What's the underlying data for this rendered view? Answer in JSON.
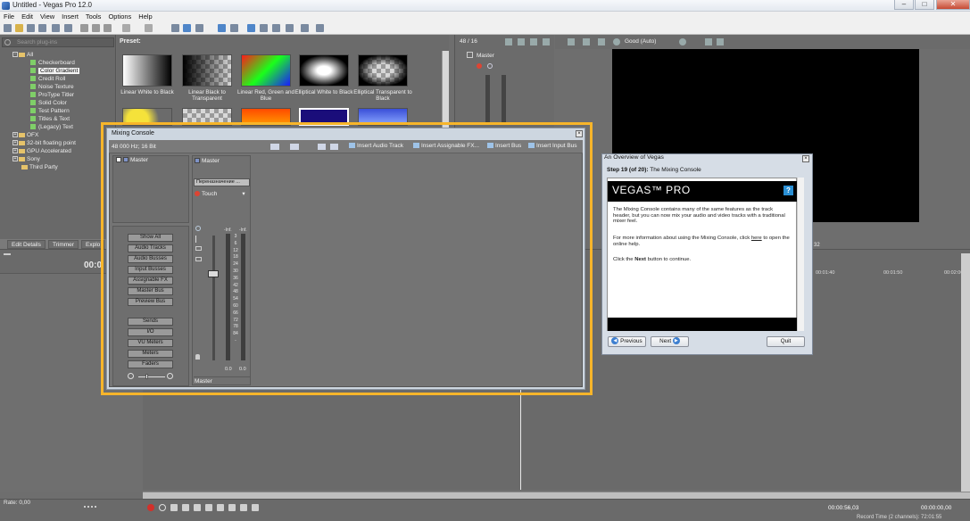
{
  "window": {
    "title": "Untitled - Vegas Pro 12.0"
  },
  "menu": [
    "File",
    "Edit",
    "View",
    "Insert",
    "Tools",
    "Options",
    "Help"
  ],
  "plugins": {
    "search_placeholder": "Search plug-ins",
    "tree": [
      {
        "label": "All",
        "type": "folder",
        "expanded": true
      },
      {
        "label": "Checkerboard",
        "type": "fx"
      },
      {
        "label": "Color Gradient",
        "type": "fx",
        "selected": true
      },
      {
        "label": "Credit Roll",
        "type": "fx"
      },
      {
        "label": "Noise Texture",
        "type": "fx"
      },
      {
        "label": "ProType Titler",
        "type": "fx"
      },
      {
        "label": "Solid Color",
        "type": "fx"
      },
      {
        "label": "Test Pattern",
        "type": "fx"
      },
      {
        "label": "Titles & Text",
        "type": "fx"
      },
      {
        "label": "(Legacy) Text",
        "type": "fx"
      },
      {
        "label": "OFX",
        "type": "folder"
      },
      {
        "label": "32-bit floating point",
        "type": "folder"
      },
      {
        "label": "GPU Accelerated",
        "type": "folder"
      },
      {
        "label": "Sony",
        "type": "folder"
      },
      {
        "label": "Third Party",
        "type": "folder"
      }
    ]
  },
  "preset": {
    "title": "Preset:",
    "items": [
      {
        "label": "Linear White to Black"
      },
      {
        "label": "Linear Black to Transparent"
      },
      {
        "label": "Linear Red, Green and Blue"
      },
      {
        "label": "Elliptical White to Black"
      },
      {
        "label": "Elliptical Transparent to Black"
      }
    ]
  },
  "masterbus": {
    "header": "48 / 16",
    "label": "Master"
  },
  "preview": {
    "quality": "Good (Auto)"
  },
  "tabs": [
    "Edit Details",
    "Trimmer",
    "Explo"
  ],
  "timeline": {
    "timecode": "00:0",
    "ruler": [
      "00:01:40",
      "00:01:50",
      "00:02:00"
    ],
    "ruler_partial": "32"
  },
  "transport": {
    "rate": "Rate: 0,00",
    "time1": "00:00:56,03",
    "time2": "00:00:00,00",
    "record_time": "Record Time (2 channels): 72:01:55"
  },
  "mixer": {
    "title": "Mixing Console",
    "format": "48 000 Hz; 16 Bit",
    "toolbar": [
      "Insert Audio Track",
      "Insert Assignable FX...",
      "Insert Bus",
      "Insert Input Bus"
    ],
    "track_item": "Master",
    "buttons": [
      "Show All",
      "Audio Tracks",
      "Audio Busses",
      "Input Busses",
      "Assignable FX",
      "Master Bus",
      "Preview Bus"
    ],
    "buttons2": [
      "Sends",
      "I/O",
      "VU Meters",
      "Meters",
      "Faders"
    ],
    "strip": {
      "name": "Master",
      "route": "Переназначение ...",
      "touch": "Touch",
      "db_top": "-Inf.",
      "db_top2": "-Inf.",
      "ticks": [
        "3",
        "6",
        "12",
        "18",
        "24",
        "30",
        "36",
        "42",
        "48",
        "54",
        "60",
        "66",
        "72",
        "78",
        "84",
        "-"
      ],
      "peak1": "0.0",
      "peak2": "0.0",
      "footer": "Master"
    }
  },
  "overview": {
    "title": "An Overview of Vegas",
    "step": "Step 19 (of 20):",
    "step_title": "The Mixing Console",
    "logo": "VEGAS™ PRO",
    "p1": "The Mixing Console contains many of the same features as the track header, but you can now mix your audio and video tracks with a traditional mixer feel.",
    "p2a": "For more information about using the Mixing Console, click",
    "p2link": "here",
    "p2b": "to open the online help.",
    "p3a": "Click the",
    "p3b": "Next",
    "p3c": "button to continue.",
    "previous": "Previous",
    "next": "Next",
    "quit": "Quit"
  },
  "colors": {
    "highlight": "#f7b52a",
    "video_bg": "#000000"
  }
}
